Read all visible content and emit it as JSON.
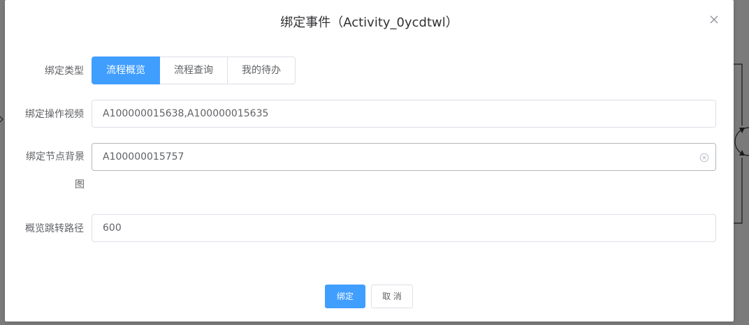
{
  "dialog": {
    "title": "绑定事件（Activity_0ycdtwl）",
    "close_icon": "close-icon"
  },
  "form": {
    "bind_type": {
      "label": "绑定类型",
      "options": [
        "流程概览",
        "流程查询",
        "我的待办"
      ],
      "selected": "流程概览"
    },
    "bind_video": {
      "label": "绑定操作视频",
      "value": "A100000015638,A100000015635"
    },
    "bind_node_bg": {
      "label": "绑定节点背景图",
      "value": "A100000015757",
      "clear_icon": "circle-close-icon"
    },
    "overview_path": {
      "label": "概览跳转路径",
      "value": "600"
    }
  },
  "footer": {
    "confirm_label": "绑定",
    "cancel_label": "取 消"
  },
  "colors": {
    "primary": "#409eff",
    "overlay": "#7b7b7b",
    "border": "#dcdfe6"
  }
}
